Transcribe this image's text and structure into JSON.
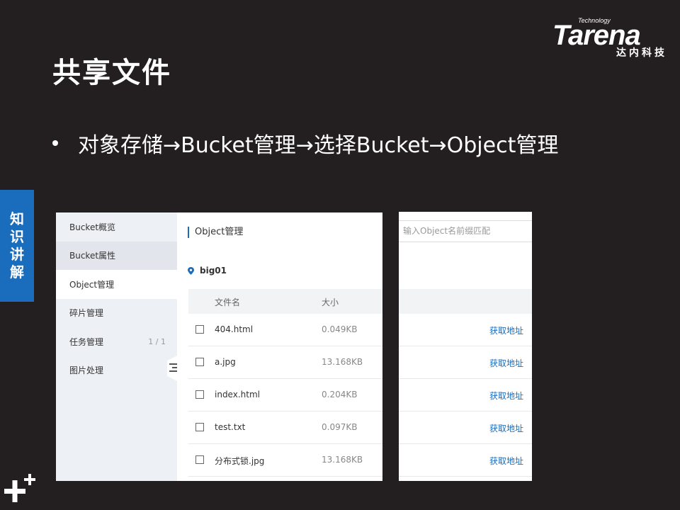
{
  "slide": {
    "title": "共享文件",
    "bullet": "对象存储→Bucket管理→选择Bucket→Object管理",
    "side_tab": [
      "知",
      "识",
      "讲",
      "解"
    ]
  },
  "logo": {
    "word": "Tarena",
    "tagline": "Technology",
    "cn": "达内科技"
  },
  "sidebar": {
    "items": [
      {
        "label": "Bucket概览",
        "count": ""
      },
      {
        "label": "Bucket属性",
        "count": ""
      },
      {
        "label": "Object管理",
        "count": ""
      },
      {
        "label": "碎片管理",
        "count": ""
      },
      {
        "label": "任务管理",
        "count": "1 / 1"
      },
      {
        "label": "图片处理",
        "count": ""
      }
    ],
    "active_index": 2
  },
  "main": {
    "breadcrumb": "Object管理",
    "bucket_name": "big01",
    "columns": {
      "name": "文件名",
      "size": "大小"
    },
    "rows": [
      {
        "name": "404.html",
        "size": "0.049KB",
        "action": "获取地址"
      },
      {
        "name": "a.jpg",
        "size": "13.168KB",
        "action": "获取地址"
      },
      {
        "name": "index.html",
        "size": "0.204KB",
        "action": "获取地址"
      },
      {
        "name": "test.txt",
        "size": "0.097KB",
        "action": "获取地址"
      },
      {
        "name": "分布式锁.jpg",
        "size": "13.168KB",
        "action": "获取地址"
      }
    ]
  },
  "search": {
    "placeholder": "输入Object名前缀匹配"
  },
  "colors": {
    "background": "#231f20",
    "accent": "#1a6cbd",
    "link": "#1a6cbd"
  }
}
